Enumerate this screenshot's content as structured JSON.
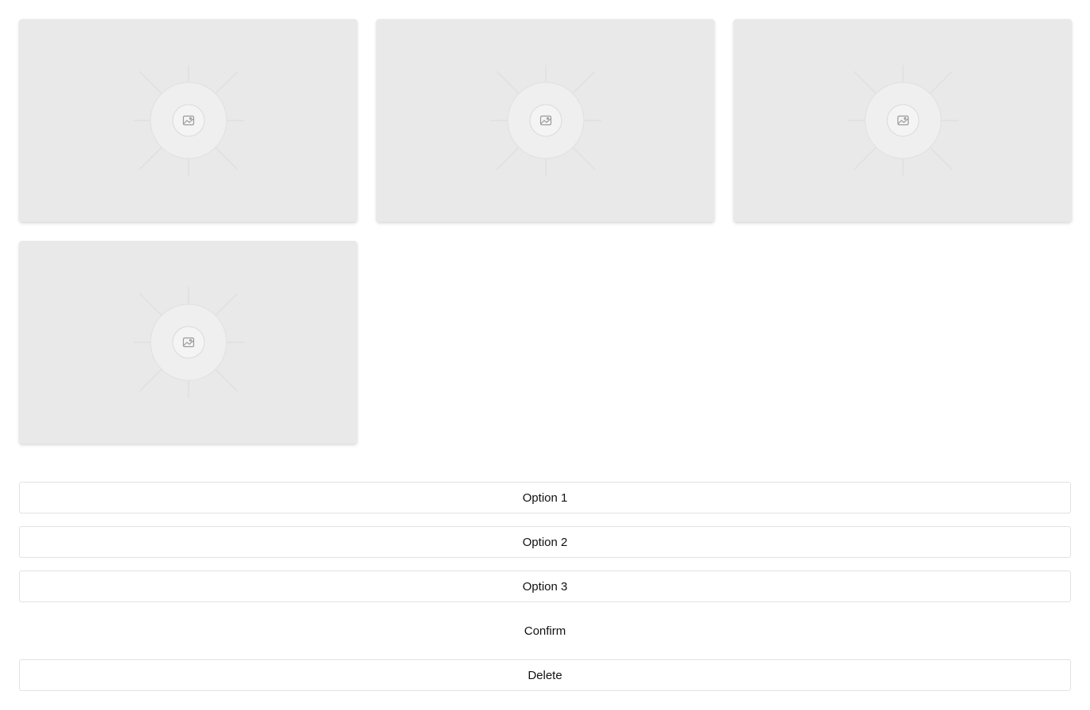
{
  "gallery": {
    "cards": [
      {
        "icon": "image-icon"
      },
      {
        "icon": "image-icon"
      },
      {
        "icon": "image-icon"
      },
      {
        "icon": "image-icon"
      }
    ]
  },
  "options": [
    {
      "label": "Option 1"
    },
    {
      "label": "Option 2"
    },
    {
      "label": "Option 3"
    }
  ],
  "actions": {
    "confirm_label": "Confirm",
    "delete_label": "Delete"
  },
  "colors": {
    "card_bg": "#e9e9e9",
    "border": "#e2e2e2",
    "text": "#111111"
  }
}
